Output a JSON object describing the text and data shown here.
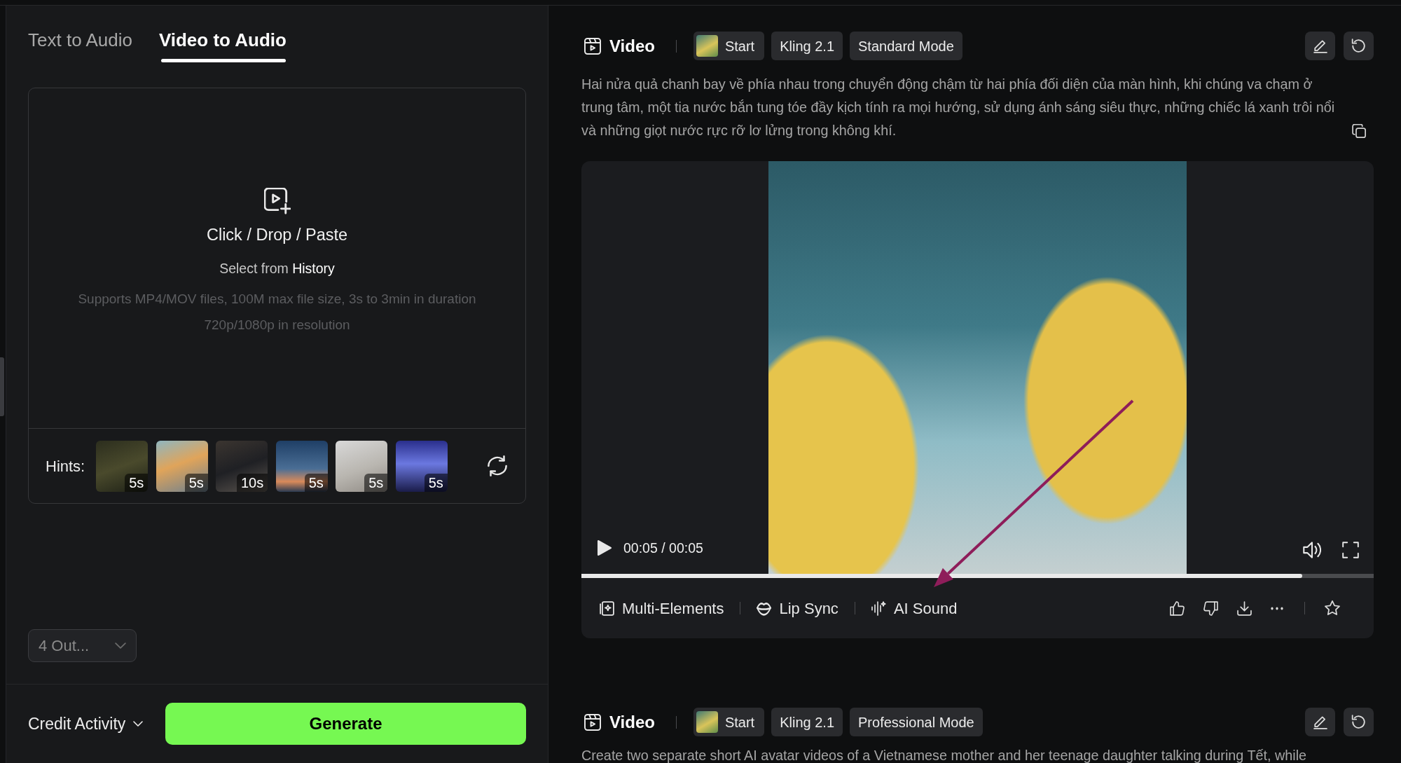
{
  "tabs": [
    {
      "label": "Text to Audio",
      "selected": false
    },
    {
      "label": "Video to Audio",
      "selected": true
    }
  ],
  "upload": {
    "title": "Click / Drop / Paste",
    "select_text": "Select from",
    "history_link": "History",
    "notes": [
      "Supports MP4/MOV files, 100M max file size, 3s to 3min in duration",
      "720p/1080p in resolution"
    ]
  },
  "hints": {
    "label": "Hints:",
    "items": [
      {
        "duration": "5s"
      },
      {
        "duration": "5s"
      },
      {
        "duration": "10s"
      },
      {
        "duration": "5s"
      },
      {
        "duration": "5s"
      },
      {
        "duration": "5s"
      }
    ]
  },
  "output_count": {
    "value": "4 Out..."
  },
  "footer": {
    "credit_activity": "Credit Activity",
    "generate_button": "Generate"
  },
  "results": [
    {
      "title": "Video",
      "tags": [
        {
          "kind": "start",
          "label": "Start"
        },
        {
          "kind": "model",
          "label": "Kling 2.1"
        },
        {
          "kind": "mode",
          "label": "Standard Mode"
        }
      ],
      "prompt": "Hai nửa quả chanh bay về phía nhau trong chuyển động chậm từ hai phía đối diện của màn hình, khi chúng va chạm ở trung tâm, một tia nước bắn tung tóe đầy kịch tính ra mọi hướng, sử dụng ánh sáng siêu thực, những chiếc lá xanh trôi nổi và những giọt nước rực rỡ lơ lửng trong không khí.",
      "player": {
        "time": "00:05 / 00:05",
        "level": 0.91
      },
      "actions": [
        {
          "kind": "multi-elements",
          "label": "Multi-Elements"
        },
        {
          "kind": "lip-sync",
          "label": "Lip Sync"
        },
        {
          "kind": "ai-sound",
          "label": "AI Sound"
        }
      ],
      "annotation": {
        "kind": "arrow"
      }
    },
    {
      "title": "Video",
      "tags": [
        {
          "kind": "start",
          "label": "Start"
        },
        {
          "kind": "model",
          "label": "Kling 2.1"
        },
        {
          "kind": "mode",
          "label": "Professional Mode"
        }
      ],
      "prompt": "Create two separate short AI avatar videos of a Vietnamese mother and her teenage daughter talking during Tết, while"
    }
  ]
}
